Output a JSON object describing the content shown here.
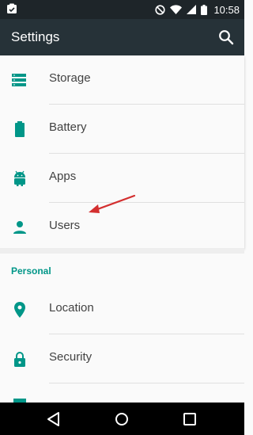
{
  "status_bar": {
    "time": "10:58"
  },
  "app_bar": {
    "title": "Settings"
  },
  "settings_list": [
    {
      "label": "Storage",
      "icon": "storage-icon"
    },
    {
      "label": "Battery",
      "icon": "battery-icon"
    },
    {
      "label": "Apps",
      "icon": "android-icon"
    },
    {
      "label": "Users",
      "icon": "person-icon"
    }
  ],
  "personal_section": {
    "header": "Personal",
    "items": [
      {
        "label": "Location",
        "icon": "location-pin-icon"
      },
      {
        "label": "Security",
        "icon": "lock-icon"
      }
    ]
  },
  "colors": {
    "status_bar": "#1e2529",
    "app_bar": "#263238",
    "accent": "#009688",
    "annotation_arrow": "#d32f2f"
  }
}
